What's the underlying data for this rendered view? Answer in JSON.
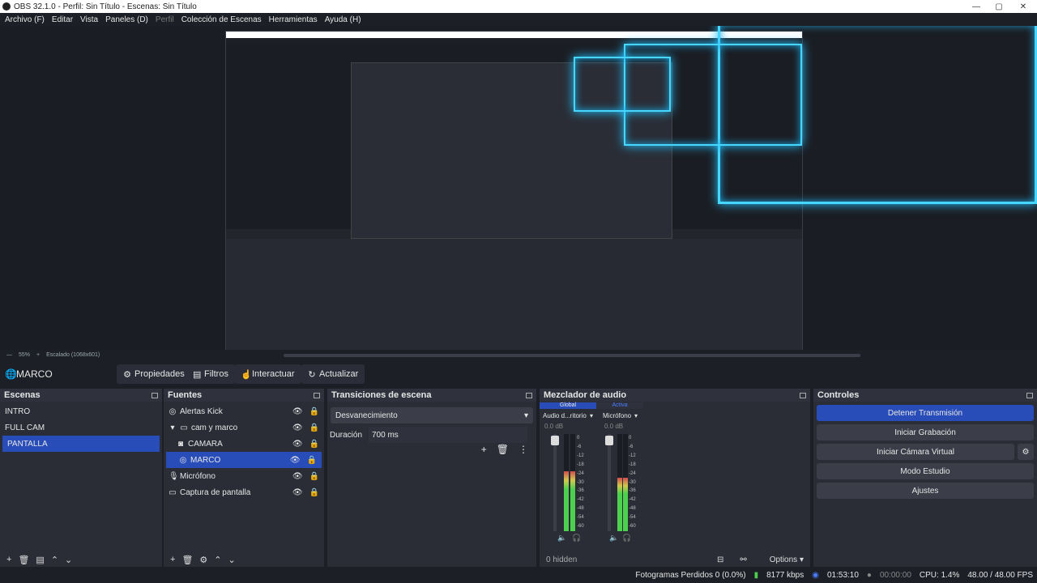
{
  "window": {
    "title": "OBS 32.1.0 - Perfil: Sin Título - Escenas: Sin Título"
  },
  "menu": [
    "Archivo (F)",
    "Editar",
    "Vista",
    "Paneles (D)",
    "Perfil",
    "Colección de Escenas",
    "Herramientas",
    "Ayuda (H)"
  ],
  "toolbar": {
    "current": "MARCO",
    "properties": "Propiedades",
    "filters": "Filtros",
    "interact": "Interactuar",
    "refresh": "Actualizar"
  },
  "zoom": {
    "level": "55%",
    "scale": "Escalado (1068x601)"
  },
  "scenes": {
    "title": "Escenas",
    "items": [
      "INTRO",
      "FULL CAM",
      "PANTALLA"
    ],
    "selected": 2
  },
  "sources": {
    "title": "Fuentes",
    "items": [
      {
        "label": "Alertas Kick",
        "icon": "globe-icon",
        "indent": 0
      },
      {
        "label": "cam y marco",
        "icon": "folder-icon",
        "indent": 1
      },
      {
        "label": "CAMARA",
        "icon": "camera-icon",
        "indent": 2
      },
      {
        "label": "MARCO",
        "icon": "globe-icon",
        "indent": 2
      },
      {
        "label": "Micrófono",
        "icon": "mic-icon",
        "indent": 0
      },
      {
        "label": "Captura de pantalla",
        "icon": "monitor-icon",
        "indent": 0
      }
    ],
    "selected": 3
  },
  "transitions": {
    "title": "Transiciones de escena",
    "value": "Desvanecimiento",
    "duration_label": "Duración",
    "duration": "700 ms"
  },
  "mixer": {
    "title": "Mezclador de audio",
    "tabs": [
      "Global",
      "Activa"
    ],
    "channels": [
      {
        "name": "Audio d...ritorio",
        "db": "0.0 dB",
        "level": 0.62
      },
      {
        "name": "Micrófono",
        "db": "0.0 dB",
        "level": 0.55
      }
    ],
    "hidden": "0 hidden",
    "options": "Options",
    "scale": [
      "0",
      "-6",
      "-12",
      "-18",
      "-24",
      "-30",
      "-36",
      "-42",
      "-48",
      "-54",
      "-60"
    ]
  },
  "controls": {
    "title": "Controles",
    "stop": "Detener Transmisión",
    "record": "Iniciar Grabación",
    "vcam": "Iniciar Cámara Virtual",
    "studio": "Modo Estudio",
    "settings": "Ajustes"
  },
  "status": {
    "dropped": "Fotogramas Perdidos 0 (0.0%)",
    "kbps": "8177 kbps",
    "stream_time": "01:53:10",
    "rec_time": "00:00:00",
    "cpu": "CPU: 1.4%",
    "fps": "48.00 / 48.00 FPS"
  },
  "colors": {
    "accent": "#284cb8",
    "glow": "#47d6ff"
  }
}
